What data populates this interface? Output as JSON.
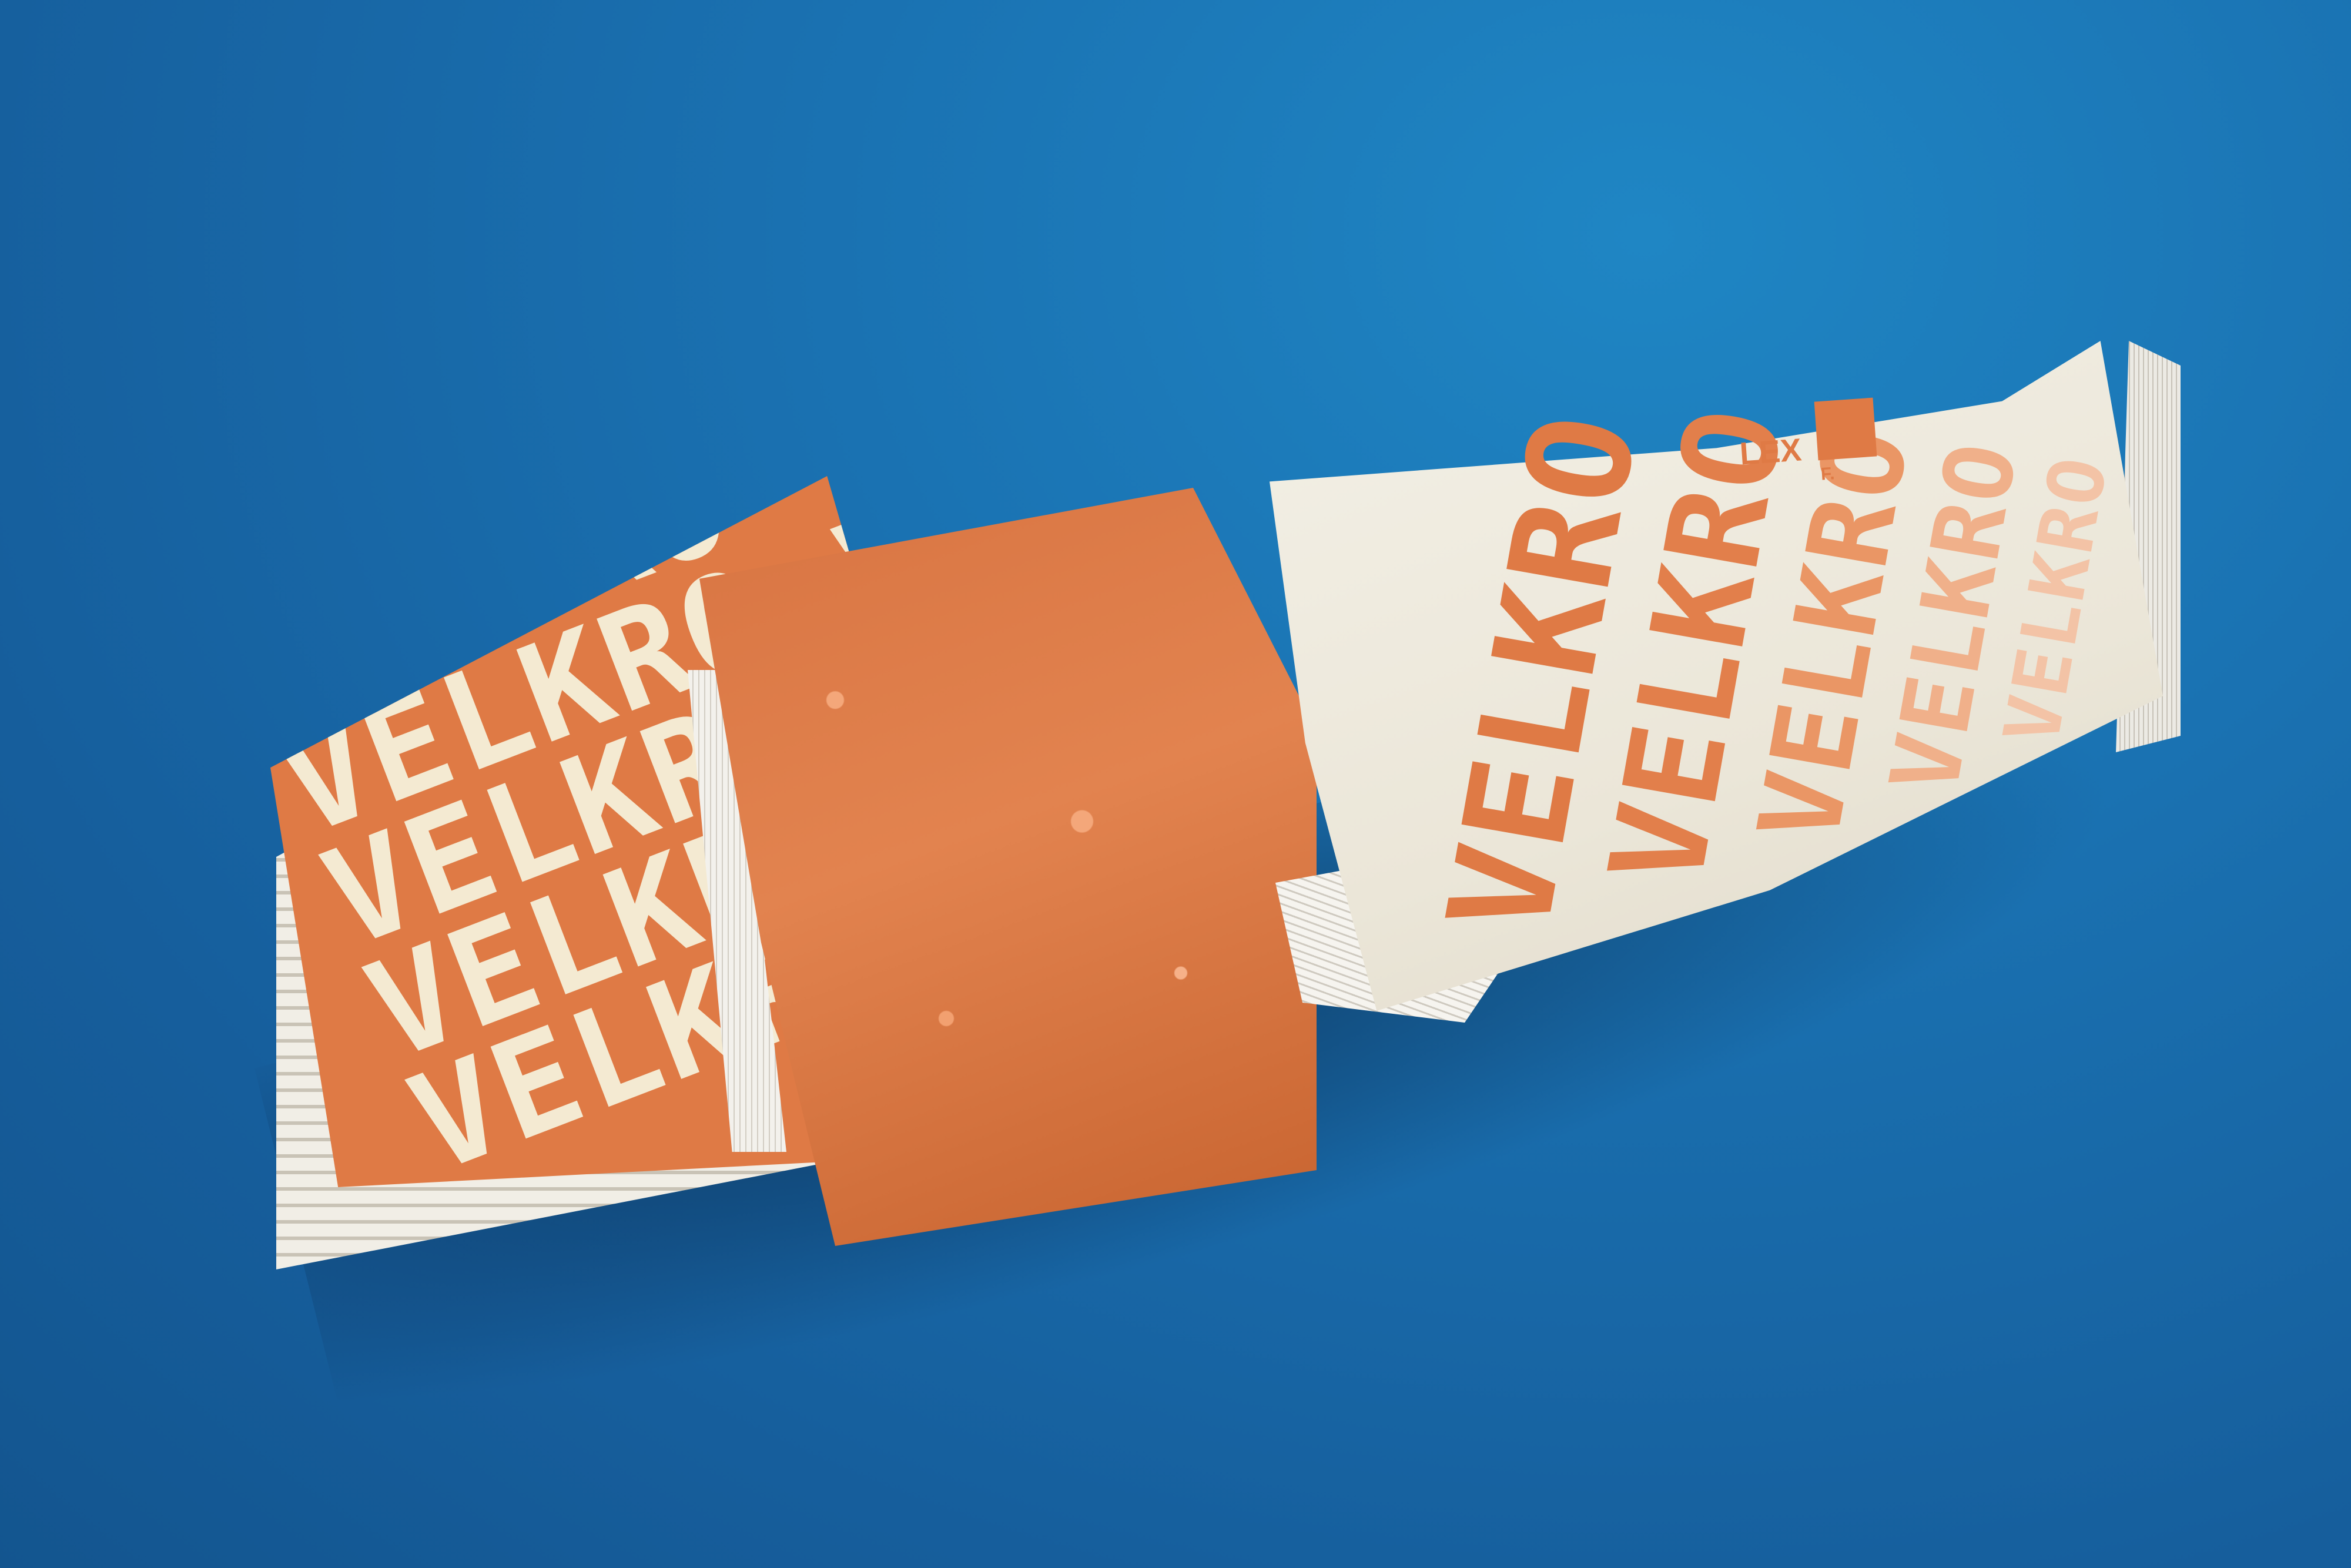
{
  "scene": {
    "background_color": "#1a72b2",
    "accent_color": "#df7a45",
    "paper_color": "#f3f0e6"
  },
  "cover_pattern": {
    "rows": [
      "VELKRO VELKRO VELKRO",
      "VELKRO VELKRO VELKRO",
      "VELKRO VELKRO VELKRO",
      "VELKRO VELKRO VELKRO",
      "VELKRO VELKRO VELKRO",
      "VELKRO VELKRO VELKRO"
    ]
  },
  "right_page": {
    "logo_word": "LEX",
    "logo_mark": "F.",
    "words": [
      "VELKRO",
      "VELKRO",
      "VELKRO",
      "VELKRO",
      "VELKRO"
    ]
  }
}
